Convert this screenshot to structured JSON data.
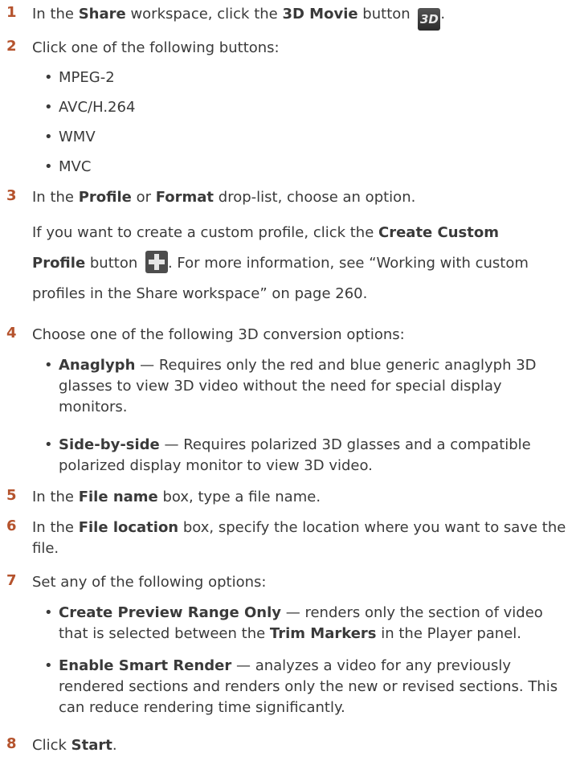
{
  "steps": [
    {
      "n": "1",
      "a": "In the ",
      "b1": "Share",
      "c": " workspace, click the ",
      "b2": "3D Movie",
      "d": " button ",
      "e": "."
    },
    {
      "n": "2",
      "text": "Click one of the following buttons:"
    },
    {
      "n": "3",
      "a": "In the ",
      "b1": "Profile",
      "c": " or ",
      "b2": "Format",
      "d": " drop-list, choose an option."
    },
    {
      "n": "4",
      "text": "Choose one of the following 3D conversion options:"
    },
    {
      "n": "5",
      "a": "In the ",
      "b1": "File name",
      "c": " box, type a file name."
    },
    {
      "n": "6",
      "a": "In the ",
      "b1": "File location",
      "c": " box, specify the location where you want to save the file."
    },
    {
      "n": "7",
      "text": "Set any of the following options:"
    },
    {
      "n": "8",
      "a": "Click ",
      "b1": "Start",
      "c": "."
    }
  ],
  "formats": [
    "MPEG-2",
    "AVC/H.264",
    "WMV",
    "MVC"
  ],
  "step3_note": {
    "a": "If you want to create a custom profile, click the ",
    "b1": "Create Custom",
    "b2": "Profile",
    "c": " button ",
    "d": ". For more information, see “Working with custom profiles in the Share workspace” on page 260."
  },
  "conversion_options": [
    {
      "name": "Anaglyph",
      "desc": " — Requires only the red and blue generic anaglyph 3D glasses to view 3D video without the need for special display monitors."
    },
    {
      "name": "Side-by-side",
      "desc": " — Requires polarized 3D glasses and a compatible polarized display monitor to view 3D video."
    }
  ],
  "render_options": [
    {
      "name": "Create Preview Range Only",
      "d1": " — renders only the section of video that is selected between the ",
      "b": "Trim Markers",
      "d2": " in the Player panel."
    },
    {
      "name": "Enable Smart Render",
      "d1": " — analyzes a video for any previously rendered sections and renders only the new or revised sections. This can reduce rendering time significantly.",
      "b": "",
      "d2": ""
    }
  ],
  "icons": {
    "movie3d": "3d-movie-icon",
    "add": "plus-icon"
  },
  "icon_label_3d": "3D",
  "colors": {
    "step_number": "#b5532d",
    "text": "#3a3a3a"
  }
}
